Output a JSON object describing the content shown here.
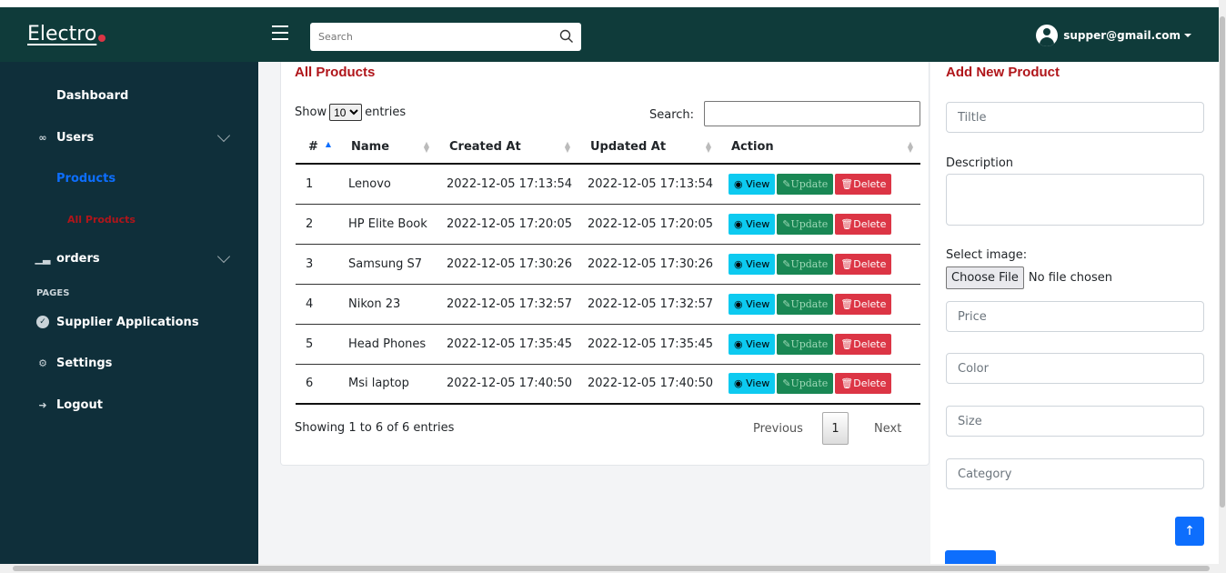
{
  "brand": {
    "name": "Electro"
  },
  "header": {
    "search_placeholder": "Search",
    "user_email": "supper@gmail.com"
  },
  "sidebar": {
    "items": [
      {
        "label": "Dashboard"
      },
      {
        "label": "Users"
      },
      {
        "label": "Products"
      },
      {
        "label": "All Products"
      },
      {
        "label": "orders"
      },
      {
        "label": "Supplier Applications"
      },
      {
        "label": "Settings"
      },
      {
        "label": "Logout"
      }
    ],
    "section_label": "PAGES"
  },
  "products": {
    "title": "All Products",
    "show_label": "Show",
    "entries_label": "entries",
    "entries_value": "10",
    "search_label": "Search:",
    "columns": [
      "#",
      "Name",
      "Created At",
      "Updated At",
      "Action"
    ],
    "rows": [
      {
        "id": "1",
        "name": "Lenovo",
        "created": "2022-12-05 17:13:54",
        "updated": "2022-12-05 17:13:54"
      },
      {
        "id": "2",
        "name": "HP Elite Book",
        "created": "2022-12-05 17:20:05",
        "updated": "2022-12-05 17:20:05"
      },
      {
        "id": "3",
        "name": "Samsung S7",
        "created": "2022-12-05 17:30:26",
        "updated": "2022-12-05 17:30:26"
      },
      {
        "id": "4",
        "name": "Nikon 23",
        "created": "2022-12-05 17:32:57",
        "updated": "2022-12-05 17:32:57"
      },
      {
        "id": "5",
        "name": "Head Phones",
        "created": "2022-12-05 17:35:45",
        "updated": "2022-12-05 17:35:45"
      },
      {
        "id": "6",
        "name": "Msi laptop",
        "created": "2022-12-05 17:40:50",
        "updated": "2022-12-05 17:40:50"
      }
    ],
    "actions": {
      "view": "View",
      "update": "Update",
      "delete": "Delete"
    },
    "info": "Showing 1 to 6 of 6 entries",
    "pagination": {
      "previous": "Previous",
      "page": "1",
      "next": "Next"
    }
  },
  "add_product": {
    "title": "Add New Product",
    "title_placeholder": "Tiltle",
    "description_label": "Description",
    "image_label": "Select image:",
    "file_button": "Choose File",
    "file_status": "No file chosen",
    "price_placeholder": "Price",
    "color_placeholder": "Color",
    "size_placeholder": "Size",
    "category_placeholder": "Category"
  },
  "colors": {
    "topbar": "#0f3b3a",
    "sidebar": "#0f2f3a",
    "accent_red": "#b0151a",
    "products_link": "#0d6efd"
  }
}
